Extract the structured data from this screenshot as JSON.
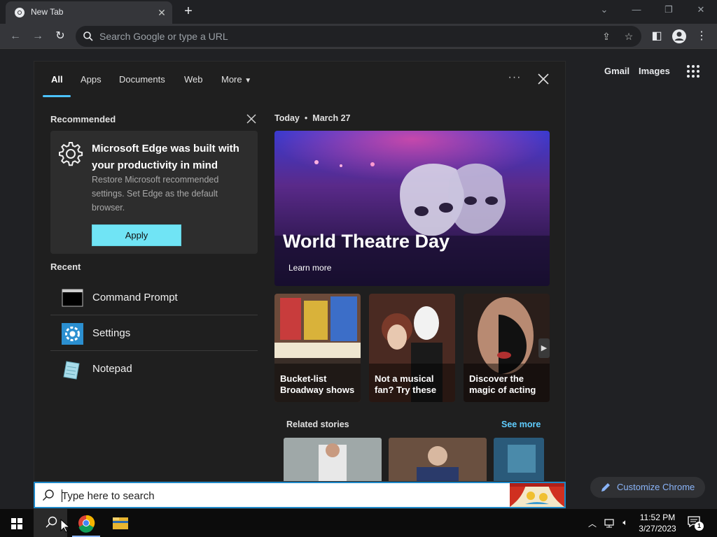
{
  "browser": {
    "tab_title": "New Tab",
    "omnibox_placeholder": "Search Google or type a URL",
    "links": {
      "gmail": "Gmail",
      "images": "Images"
    },
    "customize_label": "Customize Chrome"
  },
  "search_panel": {
    "tabs": [
      "All",
      "Apps",
      "Documents",
      "Web",
      "More"
    ],
    "active_tab": "All",
    "recommended": {
      "label": "Recommended",
      "title": "Microsoft Edge was built with your productivity in mind",
      "description": "Restore Microsoft recommended settings. Set Edge as the default browser.",
      "button": "Apply"
    },
    "recent": {
      "label": "Recent",
      "items": [
        {
          "label": "Command Prompt",
          "icon": "command-prompt-icon"
        },
        {
          "label": "Settings",
          "icon": "settings-gear-icon"
        },
        {
          "label": "Notepad",
          "icon": "notepad-icon"
        }
      ]
    },
    "today": {
      "label": "Today",
      "date": "March 27"
    },
    "hero": {
      "title": "World Theatre Day",
      "link": "Learn more"
    },
    "tiles": [
      {
        "label": "Bucket-list Broadway shows"
      },
      {
        "label": "Not a musical fan? Try these"
      },
      {
        "label": "Discover the magic of acting"
      }
    ],
    "related": {
      "label": "Related stories",
      "see_more": "See more"
    }
  },
  "taskbar": {
    "search_placeholder": "Type here to search",
    "apps": [
      "start-button",
      "search-button",
      "chrome",
      "file-explorer"
    ],
    "clock": {
      "time": "11:52 PM",
      "date": "3/27/2023"
    },
    "notification_count": "1"
  },
  "colors": {
    "accent": "#4cc2ff",
    "apply_button": "#70e4f5",
    "see_more": "#60cdff",
    "chrome_link": "#8ab4f8"
  }
}
